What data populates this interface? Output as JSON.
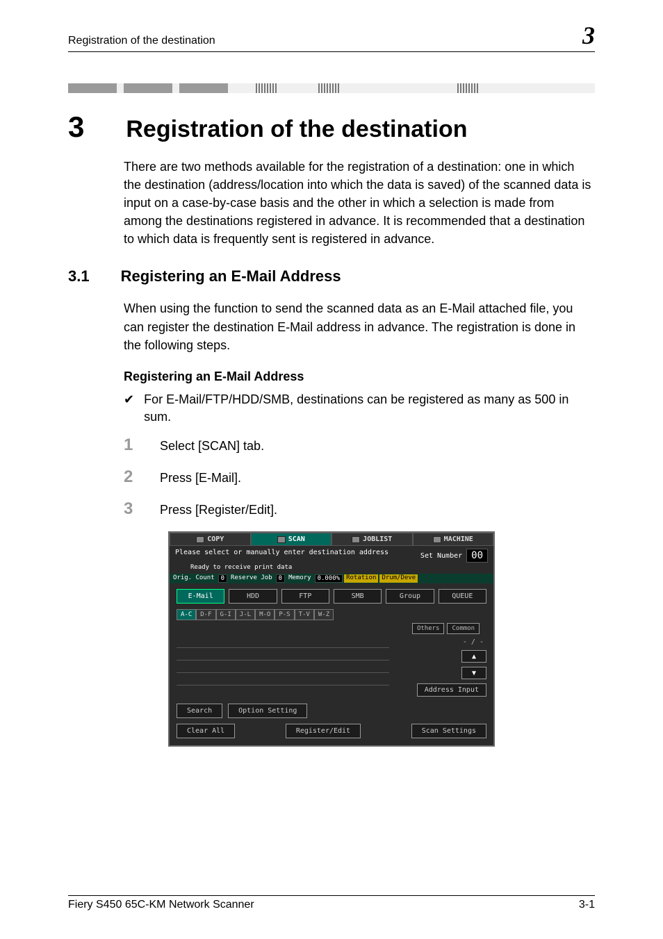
{
  "header": {
    "running_title": "Registration of the destination",
    "chapter_mark": "3"
  },
  "chapter": {
    "number": "3",
    "title": "Registration of the destination",
    "intro": "There are two methods available for the registration of a destination: one in which the destination (address/location into which the data is saved) of the scanned data is input on a case-by-case basis and the other in which a selection is made from among the destinations registered in advance. It is recommended that a destination to which data is frequently sent is registered in advance."
  },
  "section": {
    "number": "3.1",
    "title": "Registering an E-Mail Address",
    "intro": "When using the function to send the scanned data as an E-Mail attached file, you can register the destination E-Mail address in advance. The registration is done in the following steps.",
    "subhead": "Registering an E-Mail Address",
    "note": "For E-Mail/FTP/HDD/SMB, destinations can be registered as many as 500 in sum.",
    "steps": [
      {
        "n": "1",
        "text": "Select [SCAN] tab."
      },
      {
        "n": "2",
        "text": "Press [E-Mail]."
      },
      {
        "n": "3",
        "text": "Press [Register/Edit]."
      }
    ]
  },
  "device": {
    "tabs": {
      "copy": "COPY",
      "scan": "SCAN",
      "joblist": "JOBLIST",
      "machine": "MACHINE"
    },
    "prompt": "Please select or manually enter destination address",
    "ready": "Ready to receive print data",
    "set_number_label": "Set Number",
    "set_number_value": "00",
    "status": {
      "orig_count_label": "Orig. Count",
      "orig_count_val": "0",
      "reserve_label": "Reserve Job",
      "reserve_val": "0",
      "memory_label": "Memory",
      "memory_val": "0.000%",
      "rotation": "Rotation",
      "drum": "Drum/Deve"
    },
    "dest_tabs": {
      "email": "E-Mail",
      "hdd": "HDD",
      "ftp": "FTP",
      "smb": "SMB",
      "group": "Group",
      "queue": "QUEUE"
    },
    "alpha": [
      "A-C",
      "D-F",
      "G-I",
      "J-L",
      "M-O",
      "P-S",
      "T-V",
      "W-Z"
    ],
    "tags": {
      "others": "Others",
      "common": "Common"
    },
    "paging": "- / -",
    "address_input": "Address Input",
    "search": "Search",
    "option_setting": "Option Setting",
    "clear_all": "Clear All",
    "register_edit": "Register/Edit",
    "scan_settings": "Scan Settings"
  },
  "footer": {
    "left": "Fiery S450 65C-KM Network Scanner",
    "right": "3-1"
  }
}
